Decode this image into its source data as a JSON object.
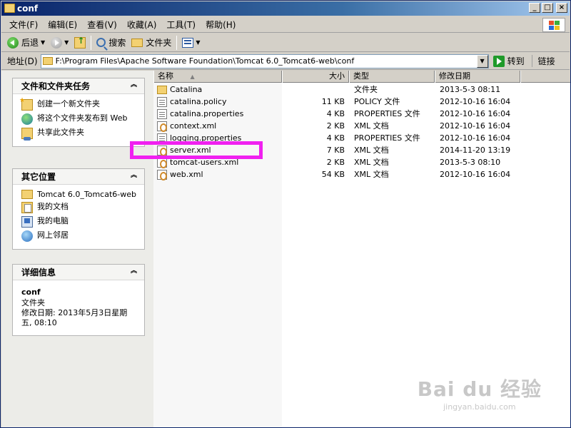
{
  "window": {
    "title": "conf"
  },
  "menu": [
    "文件(F)",
    "编辑(E)",
    "查看(V)",
    "收藏(A)",
    "工具(T)",
    "帮助(H)"
  ],
  "toolbar": {
    "back_label": "后退",
    "search_label": "搜索",
    "folders_label": "文件夹"
  },
  "address": {
    "label": "地址(D)",
    "value": "F:\\Program Files\\Apache Software Foundation\\Tomcat 6.0_Tomcat6-web\\conf",
    "go_label": "转到",
    "links_label": "链接"
  },
  "tasks_panel": {
    "title": "文件和文件夹任务",
    "items": [
      "创建一个新文件夹",
      "将这个文件夹发布到 Web",
      "共享此文件夹"
    ]
  },
  "places_panel": {
    "title": "其它位置",
    "items": [
      "Tomcat 6.0_Tomcat6-web",
      "我的文档",
      "我的电脑",
      "网上邻居"
    ]
  },
  "details_panel": {
    "title": "详细信息",
    "name": "conf",
    "type": "文件夹",
    "modified": "修改日期: 2013年5月3日星期五, 08:10"
  },
  "columns": {
    "name": "名称",
    "size": "大小",
    "type": "类型",
    "modified": "修改日期"
  },
  "files": [
    {
      "name": "Catalina",
      "size": "",
      "type": "文件夹",
      "modified": "2013-5-3 08:11",
      "icon": "folder-icon"
    },
    {
      "name": "catalina.policy",
      "size": "11 KB",
      "type": "POLICY 文件",
      "modified": "2012-10-16 16:04",
      "icon": "document-icon"
    },
    {
      "name": "catalina.properties",
      "size": "4 KB",
      "type": "PROPERTIES 文件",
      "modified": "2012-10-16 16:04",
      "icon": "document-icon"
    },
    {
      "name": "context.xml",
      "size": "2 KB",
      "type": "XML 文档",
      "modified": "2012-10-16 16:04",
      "icon": "xml-icon"
    },
    {
      "name": "logging.properties",
      "size": "4 KB",
      "type": "PROPERTIES 文件",
      "modified": "2012-10-16 16:04",
      "icon": "document-icon"
    },
    {
      "name": "server.xml",
      "size": "7 KB",
      "type": "XML 文档",
      "modified": "2014-11-20 13:19",
      "icon": "xml-icon"
    },
    {
      "name": "tomcat-users.xml",
      "size": "2 KB",
      "type": "XML 文档",
      "modified": "2013-5-3 08:10",
      "icon": "xml-icon"
    },
    {
      "name": "web.xml",
      "size": "54 KB",
      "type": "XML 文档",
      "modified": "2012-10-16 16:04",
      "icon": "xml-icon"
    }
  ],
  "highlight_color": "#f020f0",
  "watermark": {
    "main": "Bai du 经验",
    "sub": "jingyan.baidu.com"
  }
}
